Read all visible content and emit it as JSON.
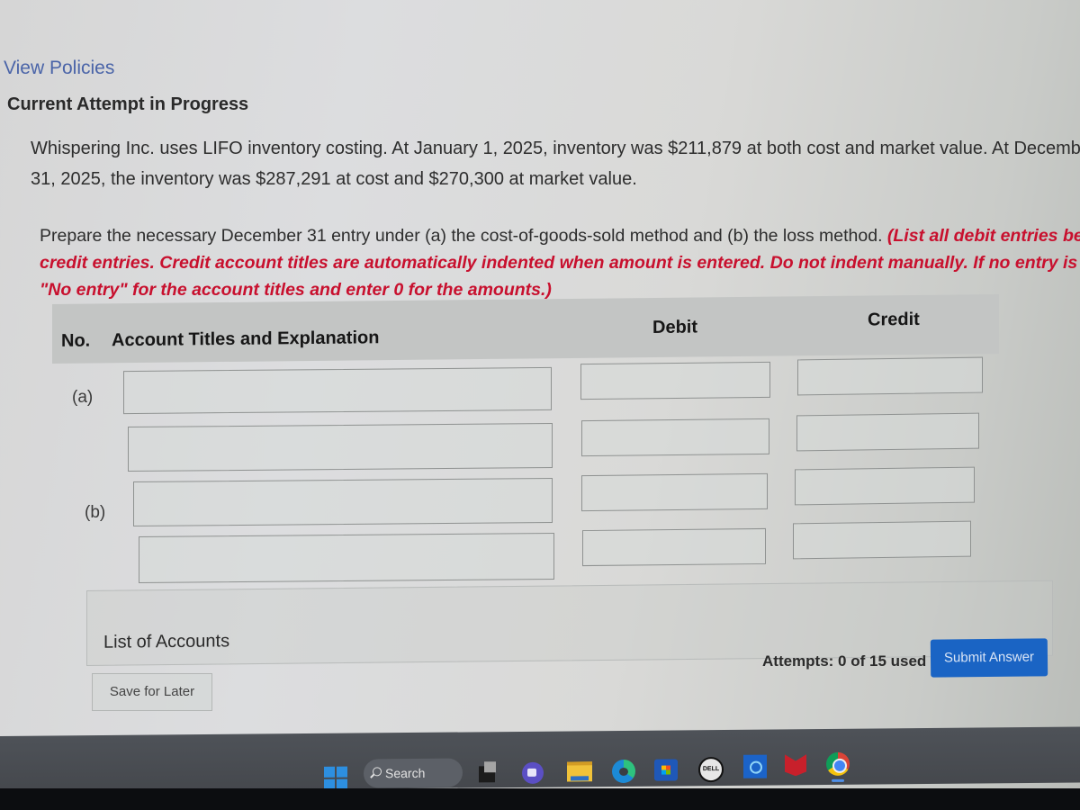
{
  "header": {
    "view_policies": "View Policies",
    "attempt_status": "Current Attempt in Progress"
  },
  "problem": {
    "line1": "Whispering Inc. uses LIFO inventory costing. At January 1, 2025, inventory was $211,879 at both cost and market value. At December",
    "line2": "31, 2025, the inventory was $287,291 at cost and $270,300 at market value."
  },
  "instructions": {
    "line1_plain": "Prepare the necessary December 31 entry under (a) the cost-of-goods-sold method and (b) the loss method. ",
    "line1_red": "(List all debit entries before",
    "line2_red": "credit entries. Credit account titles are automatically indented when amount is entered. Do not indent manually. If no entry is required, select",
    "line3_red": "\"No entry\" for the account titles and enter 0 for the amounts.)"
  },
  "table": {
    "headers": {
      "no": "No.",
      "account": "Account Titles and Explanation",
      "debit": "Debit",
      "credit": "Credit"
    },
    "rows": [
      {
        "label": "(a)",
        "account": "",
        "debit": "",
        "credit": ""
      },
      {
        "label": "",
        "account": "",
        "debit": "",
        "credit": ""
      },
      {
        "label": "(b)",
        "account": "",
        "debit": "",
        "credit": ""
      },
      {
        "label": "",
        "account": "",
        "debit": "",
        "credit": ""
      }
    ]
  },
  "footer": {
    "list_of_accounts": "List of Accounts",
    "save_for_later": "Save for Later",
    "attempts": "Attempts: 0 of 15 used",
    "submit": "Submit Answer"
  },
  "taskbar": {
    "search_label": "Search",
    "dell_label": "DELL",
    "icons": [
      "windows-start-icon",
      "search-icon",
      "task-view-icon",
      "teams-icon",
      "file-explorer-icon",
      "edge-icon",
      "store-icon",
      "dell-icon",
      "alexa-icon",
      "mcafee-icon",
      "chrome-icon"
    ]
  },
  "colors": {
    "link": "#4a64a8",
    "instruction_red": "#c8102e",
    "submit_blue": "#1a64c4",
    "header_gray": "#c3c5c4"
  }
}
